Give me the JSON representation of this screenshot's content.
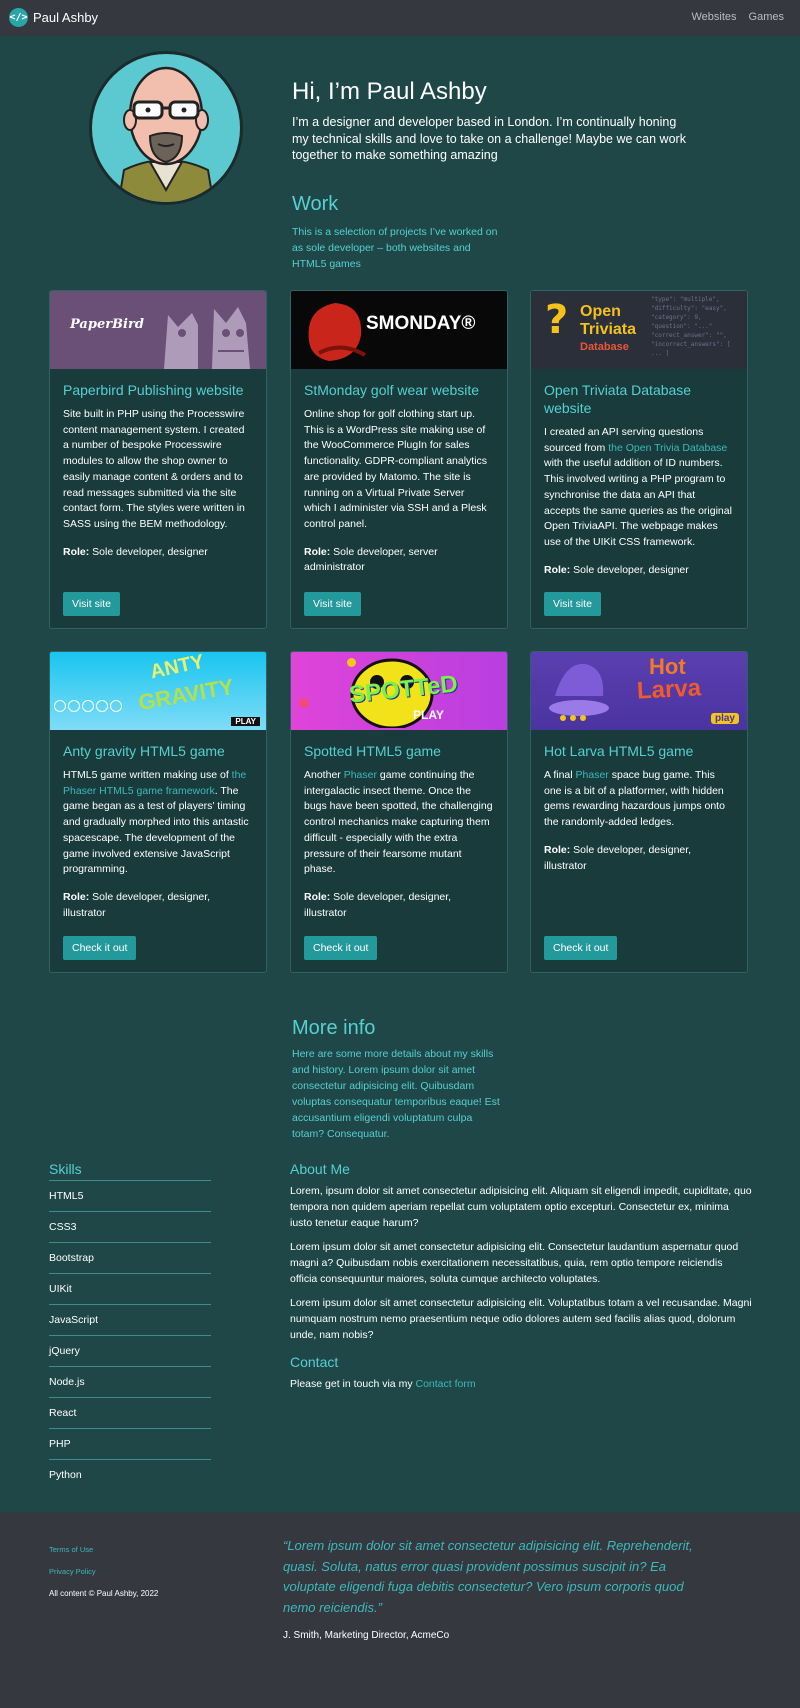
{
  "nav": {
    "brand_icon": "</>",
    "brand": "Paul Ashby",
    "links": [
      "Websites",
      "Games"
    ]
  },
  "hero": {
    "title": "Hi, I’m Paul Ashby",
    "text": "I’m a designer and developer based in London. I’m continually honing my technical skills and love to take on a challenge! Maybe we can work together to make something amazing"
  },
  "work": {
    "title": "Work",
    "lead": "This is a selection of projects I’ve worked on as sole developer – both websites and HTML5 games"
  },
  "cards": [
    {
      "image_text": "PaperBird",
      "title": "Paperbird Publishing website",
      "text": "Site built in PHP using the Processwire content management system. I created a number of bespoke Processwire modules to allow the shop owner to easily manage content & orders and to read messages submitted via the site contact form. The styles were written in SASS using the BEM methodology.",
      "role_label": "Role:",
      "role": " Sole developer, designer",
      "button": "Visit site"
    },
    {
      "image_text": "SMONDAY®",
      "title": "StMonday golf wear website",
      "text": "Online shop for golf clothing start up. This is a WordPress site making use of the WooCommerce PlugIn for sales functionality. GDPR-compliant analytics are provided by Matomo. The site is running on a Virtual Private Server which I administer via SSH and a Plesk control panel.",
      "role_label": "Role:",
      "role": " Sole developer, server administrator",
      "button": "Visit site"
    },
    {
      "image_text_1": "Open",
      "image_text_2": "Triviata",
      "image_text_3": "Database",
      "title": "Open Triviata Database website",
      "text_before": "I created an API serving questions sourced from ",
      "text_link": "the Open Trivia Database",
      "text_after": " with the useful addition of ID numbers. This involved writing a PHP program to synchronise the data an API that accepts the same queries as the original Open TriviaAPI. The webpage makes use of the UIKit CSS framework.",
      "role_label": "Role:",
      "role": " Sole developer, designer",
      "button": "Visit site"
    },
    {
      "image_text_1": "ANTY",
      "image_text_2": "GRAVITY",
      "image_play": "PLAY",
      "title": "Anty gravity HTML5 game",
      "text_before": "HTML5 game written making use of ",
      "text_link": "the Phaser HTML5 game framework",
      "text_after": ". The game began as a test of players’ timing and gradually morphed into this antastic spacescape. The development of the game involved extensive JavaScript programming.",
      "role_label": "Role:",
      "role": " Sole developer, designer, illustrator",
      "button": "Check it out"
    },
    {
      "image_text": "SPOTTeD",
      "image_play": "PLAY",
      "title": "Spotted HTML5 game",
      "text_before": "Another ",
      "text_link": "Phaser",
      "text_after": " game continuing the intergalactic insect theme. Once the bugs have been spotted, the challenging control mechanics make capturing them difficult - especially with the extra pressure of their fearsome mutant phase.",
      "role_label": "Role:",
      "role": " Sole developer, designer, illustrator",
      "button": "Check it out"
    },
    {
      "image_text_1": "Hot",
      "image_text_2": "Larva",
      "image_play": "play",
      "title": "Hot Larva HTML5 game",
      "text_before": "A final ",
      "text_link": "Phaser",
      "text_after": " space bug game. This one is a bit of a platformer, with hidden gems rewarding hazardous jumps onto the randomly-added ledges.",
      "role_label": "Role:",
      "role": " Sole developer, designer, illustrator",
      "button": "Check it out"
    }
  ],
  "more": {
    "title": "More info",
    "lead": "Here are some more details about my skills and history. Lorem ipsum dolor sit amet consectetur adipisicing elit. Quibusdam voluptas consequatur temporibus eaque! Est accusantium eligendi voluptatum culpa totam? Consequatur."
  },
  "skills": {
    "title": "Skills",
    "items": [
      "HTML5",
      "CSS3",
      "Bootstrap",
      "UIKit",
      "JavaScript",
      "jQuery",
      "Node.js",
      "React",
      "PHP",
      "Python"
    ]
  },
  "about": {
    "title": "About Me",
    "paragraphs": [
      "Lorem, ipsum dolor sit amet consectetur adipisicing elit. Aliquam sit eligendi impedit, cupiditate, quo tempora non quidem aperiam repellat cum voluptatem optio excepturi. Consectetur ex, minima iusto tenetur eaque harum?",
      "Lorem ipsum dolor sit amet consectetur adipisicing elit. Consectetur laudantium aspernatur quod magni a? Quibusdam nobis exercitationem necessitatibus, quia, rem optio tempore reiciendis officia consequuntur maiores, soluta cumque architecto voluptates.",
      "Lorem ipsum dolor sit amet consectetur adipisicing elit. Voluptatibus totam a vel recusandae. Magni numquam nostrum nemo praesentium neque odio dolores autem sed facilis alias quod, dolorum unde, nam nobis?"
    ]
  },
  "contact": {
    "title": "Contact",
    "text": "Please get in touch via my ",
    "link": "Contact form"
  },
  "footer": {
    "links": [
      "Terms of Use",
      "Privacy Policy"
    ],
    "copyright": "All content © Paul Ashby, 2022",
    "quote": "“Lorem ipsum dolor sit amet consectetur adipisicing elit. Reprehenderit, quasi. Soluta, natus error quasi provident possimus suscipit in? Ea voluptate eligendi fuga debitis consectetur? Vero ipsum corporis quod nemo reiciendis.”",
    "quote_by": "J. Smith, Marketing Director, AcmeCo"
  },
  "colors": {
    "background": "#1f4748",
    "nav_footer": "#35383f",
    "accent": "#56cfd2",
    "link": "#3bb9bc",
    "button": "#24999b",
    "card": "#1a3b3c"
  }
}
